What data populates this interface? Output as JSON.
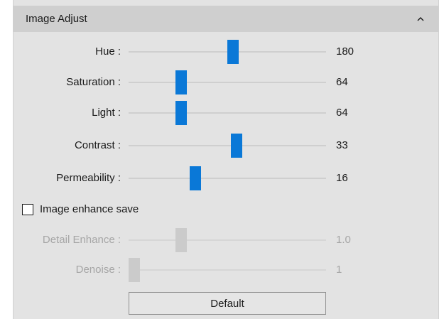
{
  "panel": {
    "title": "Image Adjust",
    "collapse_icon": "chevron-up-icon"
  },
  "sliders": [
    {
      "id": "hue",
      "label": "Hue :",
      "value": "180",
      "position": 0.53,
      "enabled": true
    },
    {
      "id": "saturation",
      "label": "Saturation :",
      "value": "64",
      "position": 0.25,
      "enabled": true
    },
    {
      "id": "light",
      "label": "Light :",
      "value": "64",
      "position": 0.25,
      "enabled": true
    },
    {
      "id": "contrast",
      "label": "Contrast :",
      "value": "33",
      "position": 0.55,
      "enabled": true
    },
    {
      "id": "permeability",
      "label": "Permeability :",
      "value": "16",
      "position": 0.33,
      "enabled": true
    },
    {
      "id": "detail-enhance",
      "label": "Detail Enhance :",
      "value": "1.0",
      "position": 0.25,
      "enabled": false
    },
    {
      "id": "denoise",
      "label": "Denoise :",
      "value": "1",
      "position": 0.0,
      "enabled": false
    }
  ],
  "enhance_save": {
    "label": "Image enhance save",
    "checked": false
  },
  "default_button": {
    "label": "Default"
  },
  "colors": {
    "accent": "#0a78d7",
    "panel_bg": "#e3e3e3",
    "header_bg": "#cfcfcf",
    "disabled_text": "#a6a6a6"
  }
}
